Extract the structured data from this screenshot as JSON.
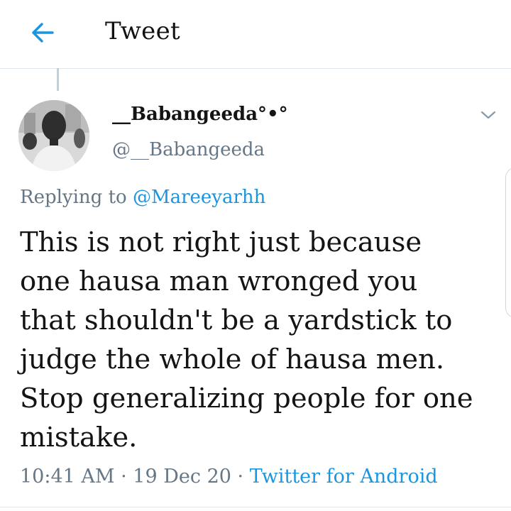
{
  "header": {
    "title": "Tweet",
    "back_icon": "arrow-left-icon",
    "accent_color": "#1b95e0"
  },
  "tweet": {
    "author": {
      "display_name": "__Babangeeda°•°",
      "handle": "@__Babangeeda",
      "avatar_icon": "profile-photo"
    },
    "menu_icon": "chevron-down-icon",
    "replying_prefix": "Replying to ",
    "replying_to": "@Mareeyarhh",
    "text": "This is not right just because\none hausa man wronged you\nthat shouldn't be a yardstick to\njudge the whole of hausa men.\nStop generalizing people for one\nmistake.",
    "time": "10:41 AM",
    "separator": " · ",
    "date": "19 Dec 20",
    "source": "Twitter for Android"
  },
  "colors": {
    "link": "#1b95e0",
    "secondary_text": "#657786",
    "divider": "#e1e8ed"
  }
}
